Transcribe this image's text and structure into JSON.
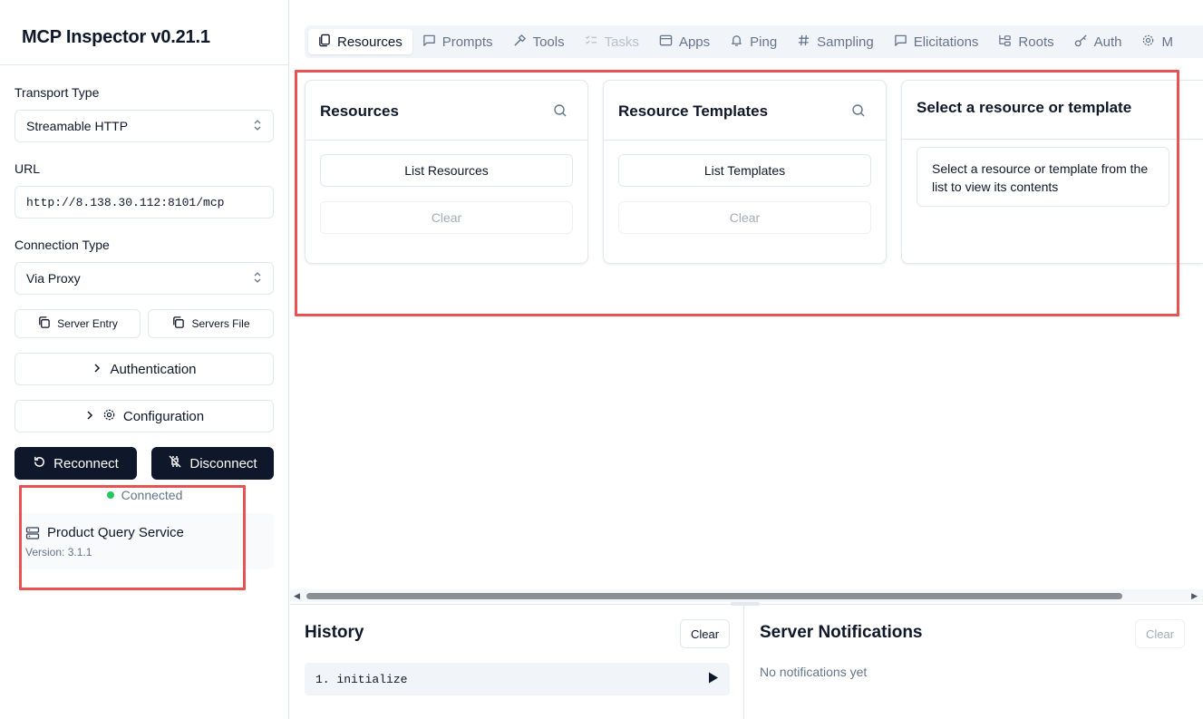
{
  "sidebar": {
    "title": "MCP Inspector v0.21.1",
    "transport_label": "Transport Type",
    "transport_value": "Streamable HTTP",
    "url_label": "URL",
    "url_value": "http://8.138.30.112:8101/mcp",
    "connection_label": "Connection Type",
    "connection_value": "Via Proxy",
    "server_entry": "Server Entry",
    "servers_file": "Servers File",
    "authentication": "Authentication",
    "configuration": "Configuration",
    "reconnect": "Reconnect",
    "disconnect": "Disconnect",
    "status": "Connected",
    "server_name": "Product Query Service",
    "server_version": "Version: 3.1.1"
  },
  "tabs": [
    {
      "label": "Resources",
      "icon": "files-icon",
      "state": "active"
    },
    {
      "label": "Prompts",
      "icon": "message-icon",
      "state": "normal"
    },
    {
      "label": "Tools",
      "icon": "hammer-icon",
      "state": "normal"
    },
    {
      "label": "Tasks",
      "icon": "list-checks-icon",
      "state": "disabled"
    },
    {
      "label": "Apps",
      "icon": "app-window-icon",
      "state": "normal"
    },
    {
      "label": "Ping",
      "icon": "bell-icon",
      "state": "normal"
    },
    {
      "label": "Sampling",
      "icon": "hash-icon",
      "state": "normal"
    },
    {
      "label": "Elicitations",
      "icon": "message-square-icon",
      "state": "normal"
    },
    {
      "label": "Roots",
      "icon": "folder-tree-icon",
      "state": "normal"
    },
    {
      "label": "Auth",
      "icon": "key-icon",
      "state": "normal"
    },
    {
      "label": "M",
      "icon": "gear-icon",
      "state": "normal"
    }
  ],
  "resources_card": {
    "title": "Resources",
    "list_button": "List Resources",
    "clear_button": "Clear"
  },
  "templates_card": {
    "title": "Resource Templates",
    "list_button": "List Templates",
    "clear_button": "Clear"
  },
  "select_card": {
    "title": "Select a resource or template",
    "message": "Select a resource or template from the list to view its contents"
  },
  "history": {
    "title": "History",
    "clear_button": "Clear",
    "items": [
      "1. initialize"
    ]
  },
  "notifications": {
    "title": "Server Notifications",
    "clear_button": "Clear",
    "empty": "No notifications yet"
  },
  "colors": {
    "accent_dark": "#0f172a",
    "status_green": "#22c55e",
    "highlight_red": "#e55353"
  }
}
